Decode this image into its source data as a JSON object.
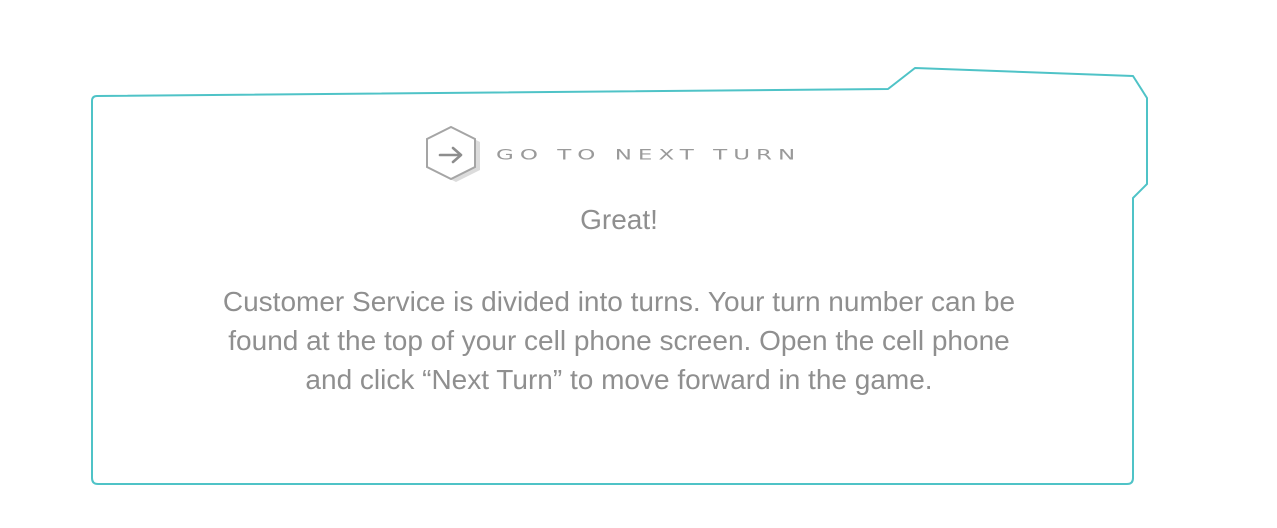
{
  "panel": {
    "accent_color": "#4fc3c7",
    "heading": {
      "icon": "arrow-right-icon",
      "label": "Go to next turn"
    },
    "exclamation": "Great!",
    "body_lines": [
      "Customer Service is divided into turns. Your turn number can be",
      "found at the top of your cell phone screen. Open the cell phone",
      "and click “Next Turn” to move forward in the game."
    ]
  }
}
